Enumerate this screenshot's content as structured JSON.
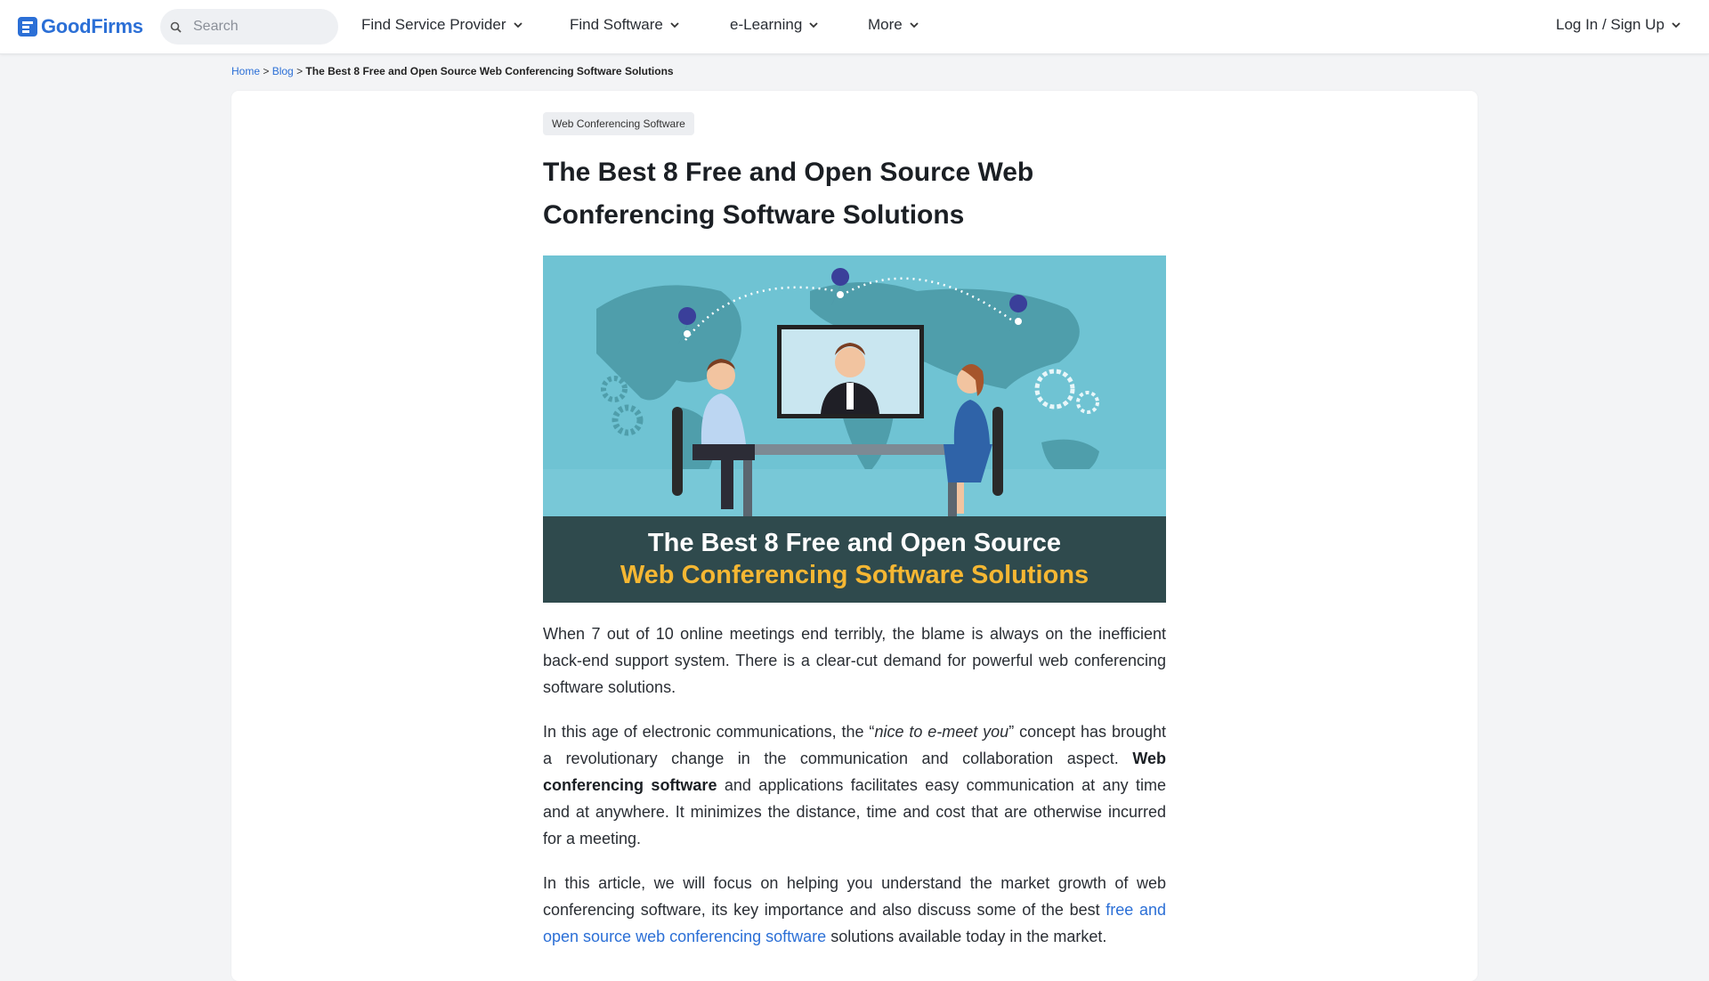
{
  "header": {
    "logo_text": "GoodFirms",
    "search_placeholder": "Search",
    "nav": [
      {
        "label": "Find Service Provider"
      },
      {
        "label": "Find Software"
      },
      {
        "label": "e-Learning"
      },
      {
        "label": "More"
      }
    ],
    "login_label": "Log In / Sign Up"
  },
  "breadcrumb": {
    "home": "Home",
    "sep1": " > ",
    "blog": "Blog",
    "sep2": " > ",
    "current": "The Best 8 Free and Open Source Web Conferencing Software Solutions"
  },
  "article": {
    "category": "Web Conferencing Software",
    "title": "The Best 8 Free and Open Source Web Conferencing Software Solutions",
    "hero": {
      "banner_line1": "The Best 8 Free and Open Source",
      "banner_line2": "Web Conferencing Software Solutions"
    },
    "paragraphs": {
      "p1": "When 7 out of 10 online meetings end terribly, the blame is always on the inefficient back-end support system. There is a clear-cut demand for powerful web conferencing software solutions.",
      "p2_a": "In this age of electronic communications, the “",
      "p2_em": "nice to e-meet you",
      "p2_b": "” concept has brought a revolutionary change in the communication and collaboration aspect. ",
      "p2_strong": "Web conferencing software",
      "p2_c": " and applications facilitates easy communication at any time and at anywhere. It minimizes the distance, time and cost that are otherwise incurred for a meeting.",
      "p3_a": "In this article, we will focus on helping you understand the market growth of web conferencing software, its key importance and also discuss some of the best ",
      "p3_link": "free and open source web conferencing software",
      "p3_b": " solutions available today in the market."
    }
  },
  "colors": {
    "brand": "#2b6fd6",
    "hero_bg": "#6fc3d3",
    "banner_bg": "#2f4a4d",
    "banner_accent": "#f5b733"
  }
}
